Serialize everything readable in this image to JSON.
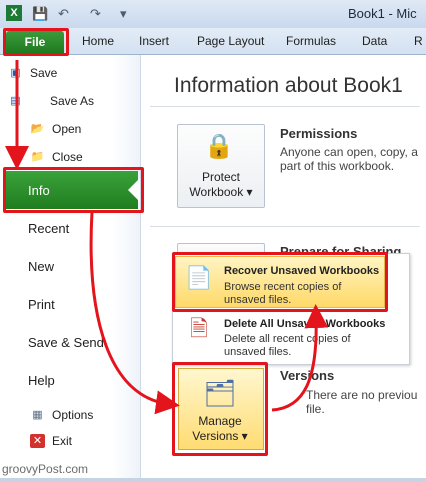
{
  "window": {
    "title": "Book1 - Mic"
  },
  "ribbon": {
    "file_tab": "File",
    "tabs": [
      "Home",
      "Insert",
      "Page Layout",
      "Formulas",
      "Data",
      "R"
    ]
  },
  "file_menu": {
    "commands": [
      "Save",
      "Save As",
      "Open",
      "Close"
    ],
    "sections": {
      "info": "Info",
      "recent": "Recent",
      "new": "New",
      "print": "Print",
      "save_send": "Save & Send",
      "help": "Help"
    },
    "bottom": [
      "Options",
      "Exit"
    ]
  },
  "main": {
    "title": "Information about Book1",
    "permissions": {
      "heading": "Permissions",
      "desc": "Anyone can open, copy, a… part of this workbook.",
      "desc_line1": "Anyone can open, copy, a",
      "desc_line2": "part of this workbook.",
      "button_line1": "Protect",
      "button_line2": "Workbook ▾"
    },
    "prepare": {
      "heading": "Prepare for Sharing"
    },
    "dropdown": {
      "recover": {
        "title": "Recover Unsaved Workbooks",
        "desc1": "Browse recent copies of",
        "desc2": "unsaved files."
      },
      "delete": {
        "title": "Delete All Unsaved Workbooks",
        "desc1": "Delete all recent copies of",
        "desc2": "unsaved files."
      }
    },
    "versions": {
      "heading": "Versions",
      "desc1": "There are no previou",
      "desc2": "file.",
      "button_line1": "Manage",
      "button_line2": "Versions ▾"
    }
  },
  "watermark": "groovyPost.com",
  "colors": {
    "accent_green": "#2a8a2a",
    "highlight_red": "#e3141b",
    "selection_gold": "#ffd968"
  }
}
